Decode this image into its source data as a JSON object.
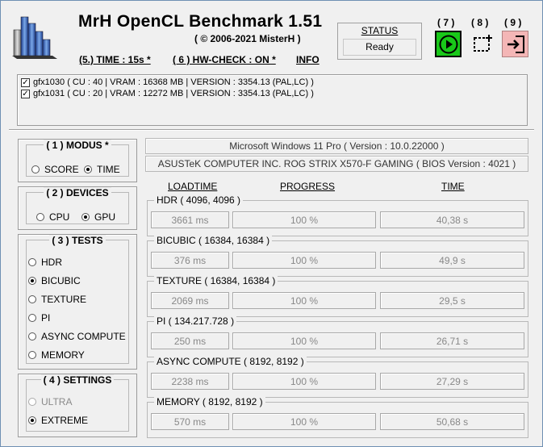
{
  "app": {
    "title": "MrH OpenCL Benchmark 1.51",
    "copyright": "( ©  2006-2021 MisterH )"
  },
  "header_links": {
    "time": "(5.) TIME : 15s *",
    "hwcheck": "( 6 ) HW-CHECK : ON *",
    "info": "INFO"
  },
  "status": {
    "label": "STATUS",
    "value": "Ready"
  },
  "toolbar": {
    "play": {
      "number": "( 7 )"
    },
    "select": {
      "number": "( 8 )"
    },
    "exit": {
      "number": "( 9 )"
    },
    "colors": {
      "play_bg": "#19c819",
      "exit_bg": "#f4b6b6"
    }
  },
  "devices": [
    {
      "checked": true,
      "label": "gfx1030 ( CU : 40 | VRAM : 16368 MB | VERSION : 3354.13 (PAL,LC) )"
    },
    {
      "checked": true,
      "label": "gfx1031 ( CU : 20 | VRAM : 12272 MB | VERSION : 3354.13 (PAL,LC) )"
    }
  ],
  "modus": {
    "title": "( 1 ) MODUS *",
    "options": [
      {
        "label": "SCORE",
        "selected": false
      },
      {
        "label": "TIME",
        "selected": true
      }
    ]
  },
  "devices_mode": {
    "title": "( 2 ) DEVICES",
    "options": [
      {
        "label": "CPU",
        "selected": false
      },
      {
        "label": "GPU",
        "selected": true
      }
    ]
  },
  "tests_panel": {
    "title": "( 3 ) TESTS",
    "options": [
      {
        "label": "HDR",
        "selected": false
      },
      {
        "label": "BICUBIC",
        "selected": true
      },
      {
        "label": "TEXTURE",
        "selected": false
      },
      {
        "label": "PI",
        "selected": false
      },
      {
        "label": "ASYNC COMPUTE",
        "selected": false
      },
      {
        "label": "MEMORY",
        "selected": false
      }
    ]
  },
  "settings": {
    "title": "( 4 ) SETTINGS",
    "options": [
      {
        "label": "ULTRA",
        "selected": false,
        "disabled": true
      },
      {
        "label": "EXTREME",
        "selected": true,
        "disabled": false
      }
    ]
  },
  "system": {
    "os": "Microsoft Windows 11 Pro ( Version : 10.0.22000 )",
    "board": "ASUSTeK COMPUTER INC. ROG STRIX X570-F GAMING ( BIOS Version : 4021 )"
  },
  "columns": {
    "loadtime": "LOADTIME",
    "progress": "PROGRESS",
    "time": "TIME"
  },
  "results": [
    {
      "name": "HDR ( 4096, 4096 )",
      "loadtime": "3661 ms",
      "progress": "100 %",
      "time": "40,38  s"
    },
    {
      "name": "BICUBIC ( 16384, 16384 )",
      "loadtime": "376 ms",
      "progress": "100 %",
      "time": "49,9  s"
    },
    {
      "name": "TEXTURE ( 16384, 16384 )",
      "loadtime": "2069 ms",
      "progress": "100 %",
      "time": "29,5  s"
    },
    {
      "name": "PI ( 134.217.728 )",
      "loadtime": "250 ms",
      "progress": "100 %",
      "time": "26,71  s"
    },
    {
      "name": "ASYNC COMPUTE ( 8192, 8192 )",
      "loadtime": "2238 ms",
      "progress": "100 %",
      "time": "27,29  s"
    },
    {
      "name": "MEMORY ( 8192, 8192 )",
      "loadtime": "570 ms",
      "progress": "100 %",
      "time": "50,68  s"
    }
  ]
}
